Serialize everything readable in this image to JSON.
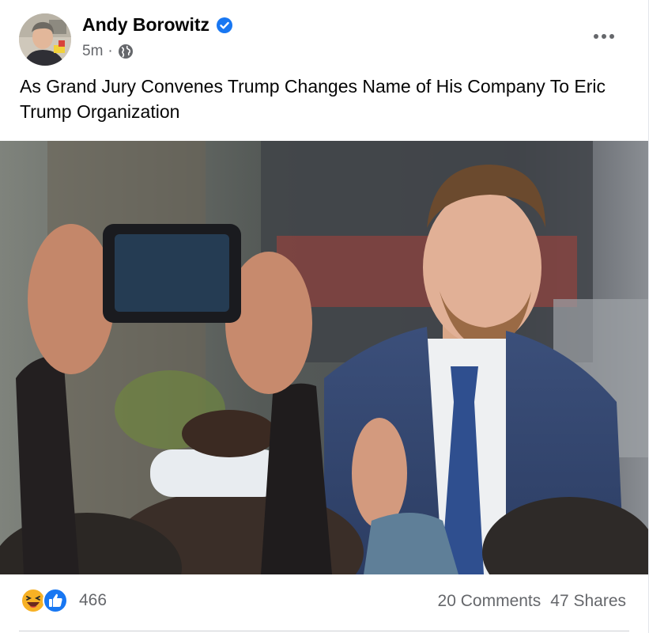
{
  "post": {
    "author": "Andy Borowitz",
    "time": "5m",
    "separator": "·",
    "privacy_icon": "globe-icon",
    "verified_icon": "verified-badge-icon",
    "more_icon": "more-options-icon",
    "text": "As Grand Jury Convenes Trump Changes Name of His Company To Eric Trump Organization"
  },
  "footer": {
    "reaction_icons": [
      "laugh-reaction-icon",
      "like-reaction-icon"
    ],
    "reaction_count": "466",
    "comments": "20 Comments",
    "shares": "47 Shares"
  },
  "colors": {
    "accent": "#1877f2",
    "secondary_text": "#65676b",
    "laugh": "#f7b125"
  }
}
